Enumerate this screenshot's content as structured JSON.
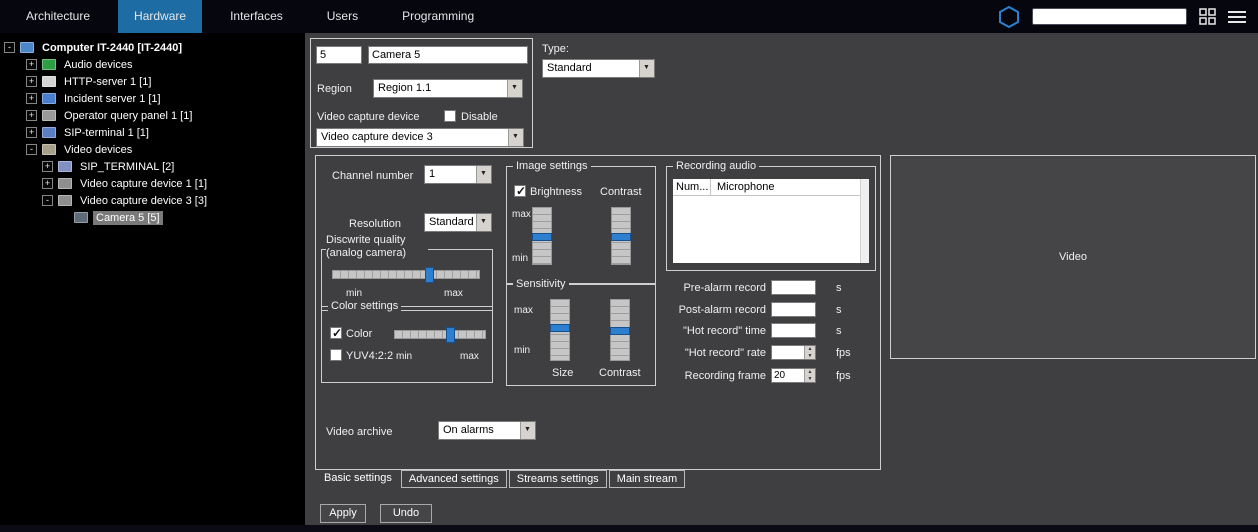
{
  "topbar": {
    "tabs": [
      {
        "label": "Architecture",
        "active": false
      },
      {
        "label": "Hardware",
        "active": true
      },
      {
        "label": "Interfaces",
        "active": false
      },
      {
        "label": "Users",
        "active": false
      },
      {
        "label": "Programming",
        "active": false
      }
    ],
    "search": {
      "value": ""
    },
    "icons": [
      "hexagon-logo-icon",
      "grid-windows-icon",
      "hamburger-menu-icon"
    ]
  },
  "tree": {
    "items": [
      {
        "label": "Computer IT-2440 [IT-2440]",
        "level": 0,
        "expander": "-",
        "icon": "computer-icon",
        "selected": false
      },
      {
        "label": "Audio devices",
        "level": 1,
        "expander": "+",
        "icon": "audio-devices-icon",
        "selected": false
      },
      {
        "label": "HTTP-server 1 [1]",
        "level": 1,
        "expander": "+",
        "icon": "http-server-icon",
        "selected": false
      },
      {
        "label": "Incident server 1 [1]",
        "level": 1,
        "expander": "+",
        "icon": "incident-server-icon",
        "selected": false
      },
      {
        "label": "Operator query panel 1 [1]",
        "level": 1,
        "expander": "+",
        "icon": "operator-panel-icon",
        "selected": false
      },
      {
        "label": "SIP-terminal 1 [1]",
        "level": 1,
        "expander": "+",
        "icon": "sip-terminal-icon",
        "selected": false
      },
      {
        "label": "Video devices",
        "level": 1,
        "expander": "-",
        "icon": "video-devices-icon",
        "selected": false
      },
      {
        "label": "SIP_TERMINAL [2]",
        "level": 2,
        "expander": "+",
        "icon": "sip-terminal-icon",
        "selected": false
      },
      {
        "label": "Video capture device 1 [1]",
        "level": 2,
        "expander": "+",
        "icon": "capture-device-icon",
        "selected": false
      },
      {
        "label": "Video capture device 3 [3]",
        "level": 2,
        "expander": "-",
        "icon": "capture-device-icon",
        "selected": false
      },
      {
        "label": "Camera 5 [5]",
        "level": 3,
        "expander": null,
        "icon": "camera-icon",
        "selected": true
      }
    ]
  },
  "identity": {
    "id_value": "5",
    "name_value": "Camera 5",
    "region_label": "Region",
    "region_value": "Region 1.1",
    "device_label": "Video capture device",
    "disable_label": "Disable",
    "device_value": "Video capture device 3",
    "type_label": "Type:",
    "type_value": "Standard"
  },
  "panel": {
    "channel_label": "Channel number",
    "channel_value": "1",
    "resolution_label": "Resolution",
    "resolution_value": "Standard",
    "quality_label": "Discwrite quality (analog camera)",
    "quality_min": "min",
    "quality_max": "max",
    "color_group_label": "Color settings",
    "color_checkbox_label": "Color",
    "yuv_checkbox_label": "YUV4:2:2",
    "color_min": "min",
    "color_max": "max",
    "image_group_label": "Image settings",
    "brightness_label": "Brightness",
    "contrast_label": "Contrast",
    "image_max": "max",
    "image_min": "min",
    "sensitivity_group_label": "Sensitivity",
    "sens_max": "max",
    "sens_min": "min",
    "size_label": "Size",
    "sens_contrast_label": "Contrast",
    "recording_group_label": "Recording audio",
    "table_headers": [
      "Num...",
      "Microphone"
    ],
    "fields": [
      {
        "label": "Pre-alarm record",
        "value": "",
        "unit": "s"
      },
      {
        "label": "Post-alarm record",
        "value": "",
        "unit": "s"
      },
      {
        "label": "\"Hot record\" time",
        "value": "",
        "unit": "s"
      },
      {
        "label": "\"Hot record\" rate",
        "value": "",
        "unit": "fps"
      },
      {
        "label": "Recording frame",
        "value": "20",
        "unit": "fps"
      }
    ],
    "archive_label": "Video archive",
    "archive_value": "On alarms",
    "tabs": [
      {
        "label": "Basic settings",
        "active": true
      },
      {
        "label": "Advanced settings",
        "active": false
      },
      {
        "label": "Streams settings",
        "active": false
      },
      {
        "label": "Main stream",
        "active": false
      }
    ]
  },
  "video_panel": {
    "label": "Video"
  },
  "actions": {
    "apply_label": "Apply",
    "undo_label": "Undo"
  }
}
